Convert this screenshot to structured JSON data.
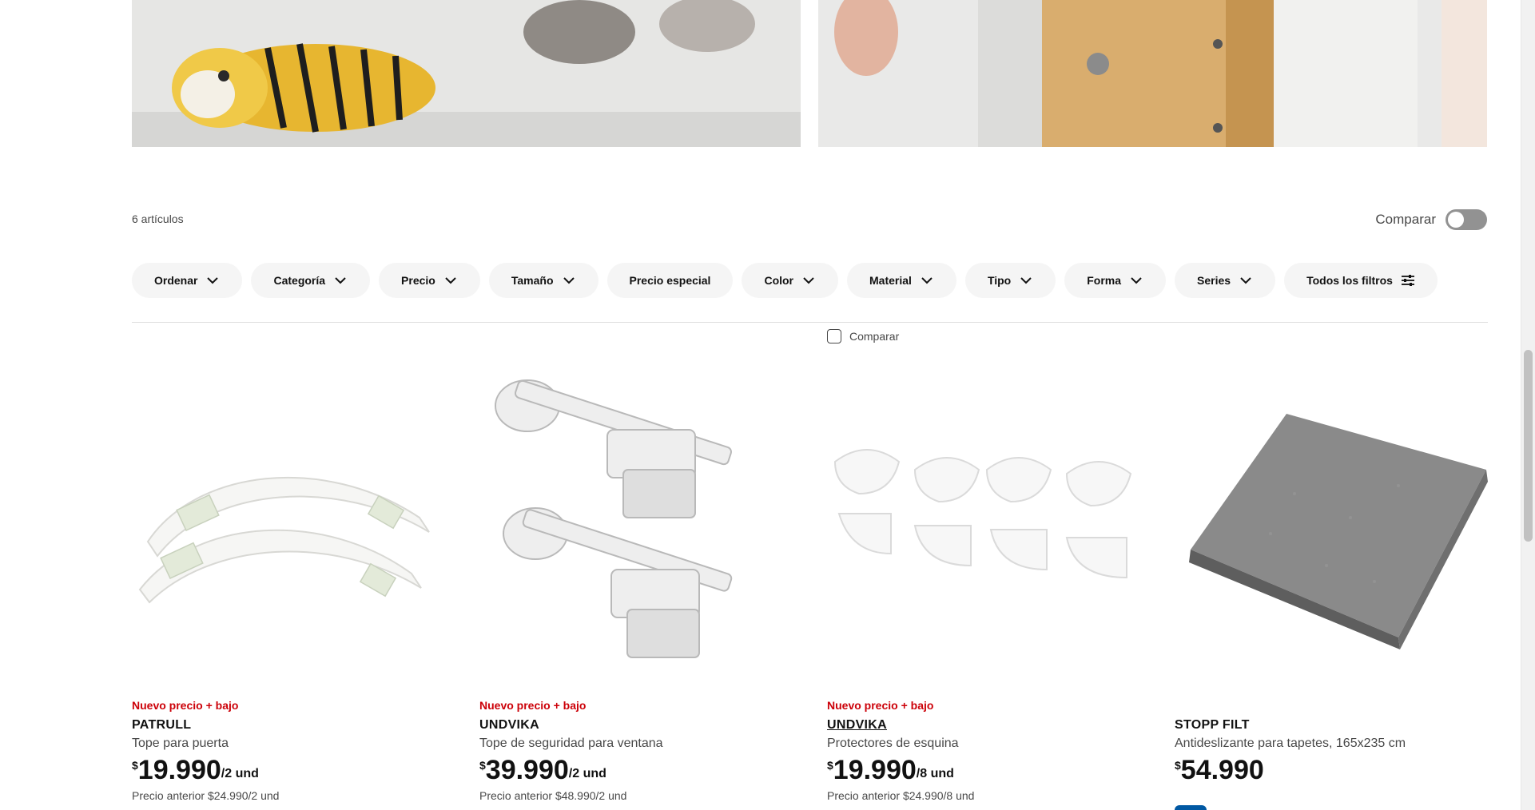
{
  "list": {
    "count_label": "6 artículos",
    "compare_label": "Comparar"
  },
  "filters": [
    {
      "label": "Ordenar",
      "icon": "chevron-down-icon"
    },
    {
      "label": "Categoría",
      "icon": "chevron-down-icon"
    },
    {
      "label": "Precio",
      "icon": "chevron-down-icon"
    },
    {
      "label": "Tamaño",
      "icon": "chevron-down-icon"
    },
    {
      "label": "Precio especial",
      "icon": ""
    },
    {
      "label": "Color",
      "icon": "chevron-down-icon"
    },
    {
      "label": "Material",
      "icon": "chevron-down-icon"
    },
    {
      "label": "Tipo",
      "icon": "chevron-down-icon"
    },
    {
      "label": "Forma",
      "icon": "chevron-down-icon"
    },
    {
      "label": "Series",
      "icon": "chevron-down-icon"
    },
    {
      "label": "Todos los filtros",
      "icon": "sliders-icon"
    }
  ],
  "product_compare_label": "Comparar",
  "products": [
    {
      "badge": "Nuevo precio + bajo",
      "name": "PATRULL",
      "description": "Tope para puerta",
      "currency": "$",
      "price": "19.990",
      "unit": "/2 und",
      "previous_label": "Precio anterior",
      "previous_price": "$24.990/2 und"
    },
    {
      "badge": "Nuevo precio + bajo",
      "name": "UNDVIKA",
      "description": "Tope de seguridad para ventana",
      "currency": "$",
      "price": "39.990",
      "unit": "/2 und",
      "previous_label": "Precio anterior",
      "previous_price": "$48.990/2 und"
    },
    {
      "badge": "Nuevo precio + bajo",
      "name": "UNDVIKA",
      "description": "Protectores de esquina",
      "currency": "$",
      "price": "19.990",
      "unit": "/8 und",
      "previous_label": "Precio anterior",
      "previous_price": "$24.990/8 und"
    },
    {
      "badge": "",
      "name": "STOPP FILT",
      "description": "Antideslizante para tapetes, 165x235 cm",
      "currency": "$",
      "price": "54.990",
      "unit": "",
      "previous_label": "",
      "previous_price": ""
    }
  ],
  "colors": {
    "badge_red": "#cc0008",
    "pill_bg": "#f5f5f5",
    "toggle_off": "#929292",
    "text_primary": "#111111",
    "text_secondary": "#484848"
  }
}
